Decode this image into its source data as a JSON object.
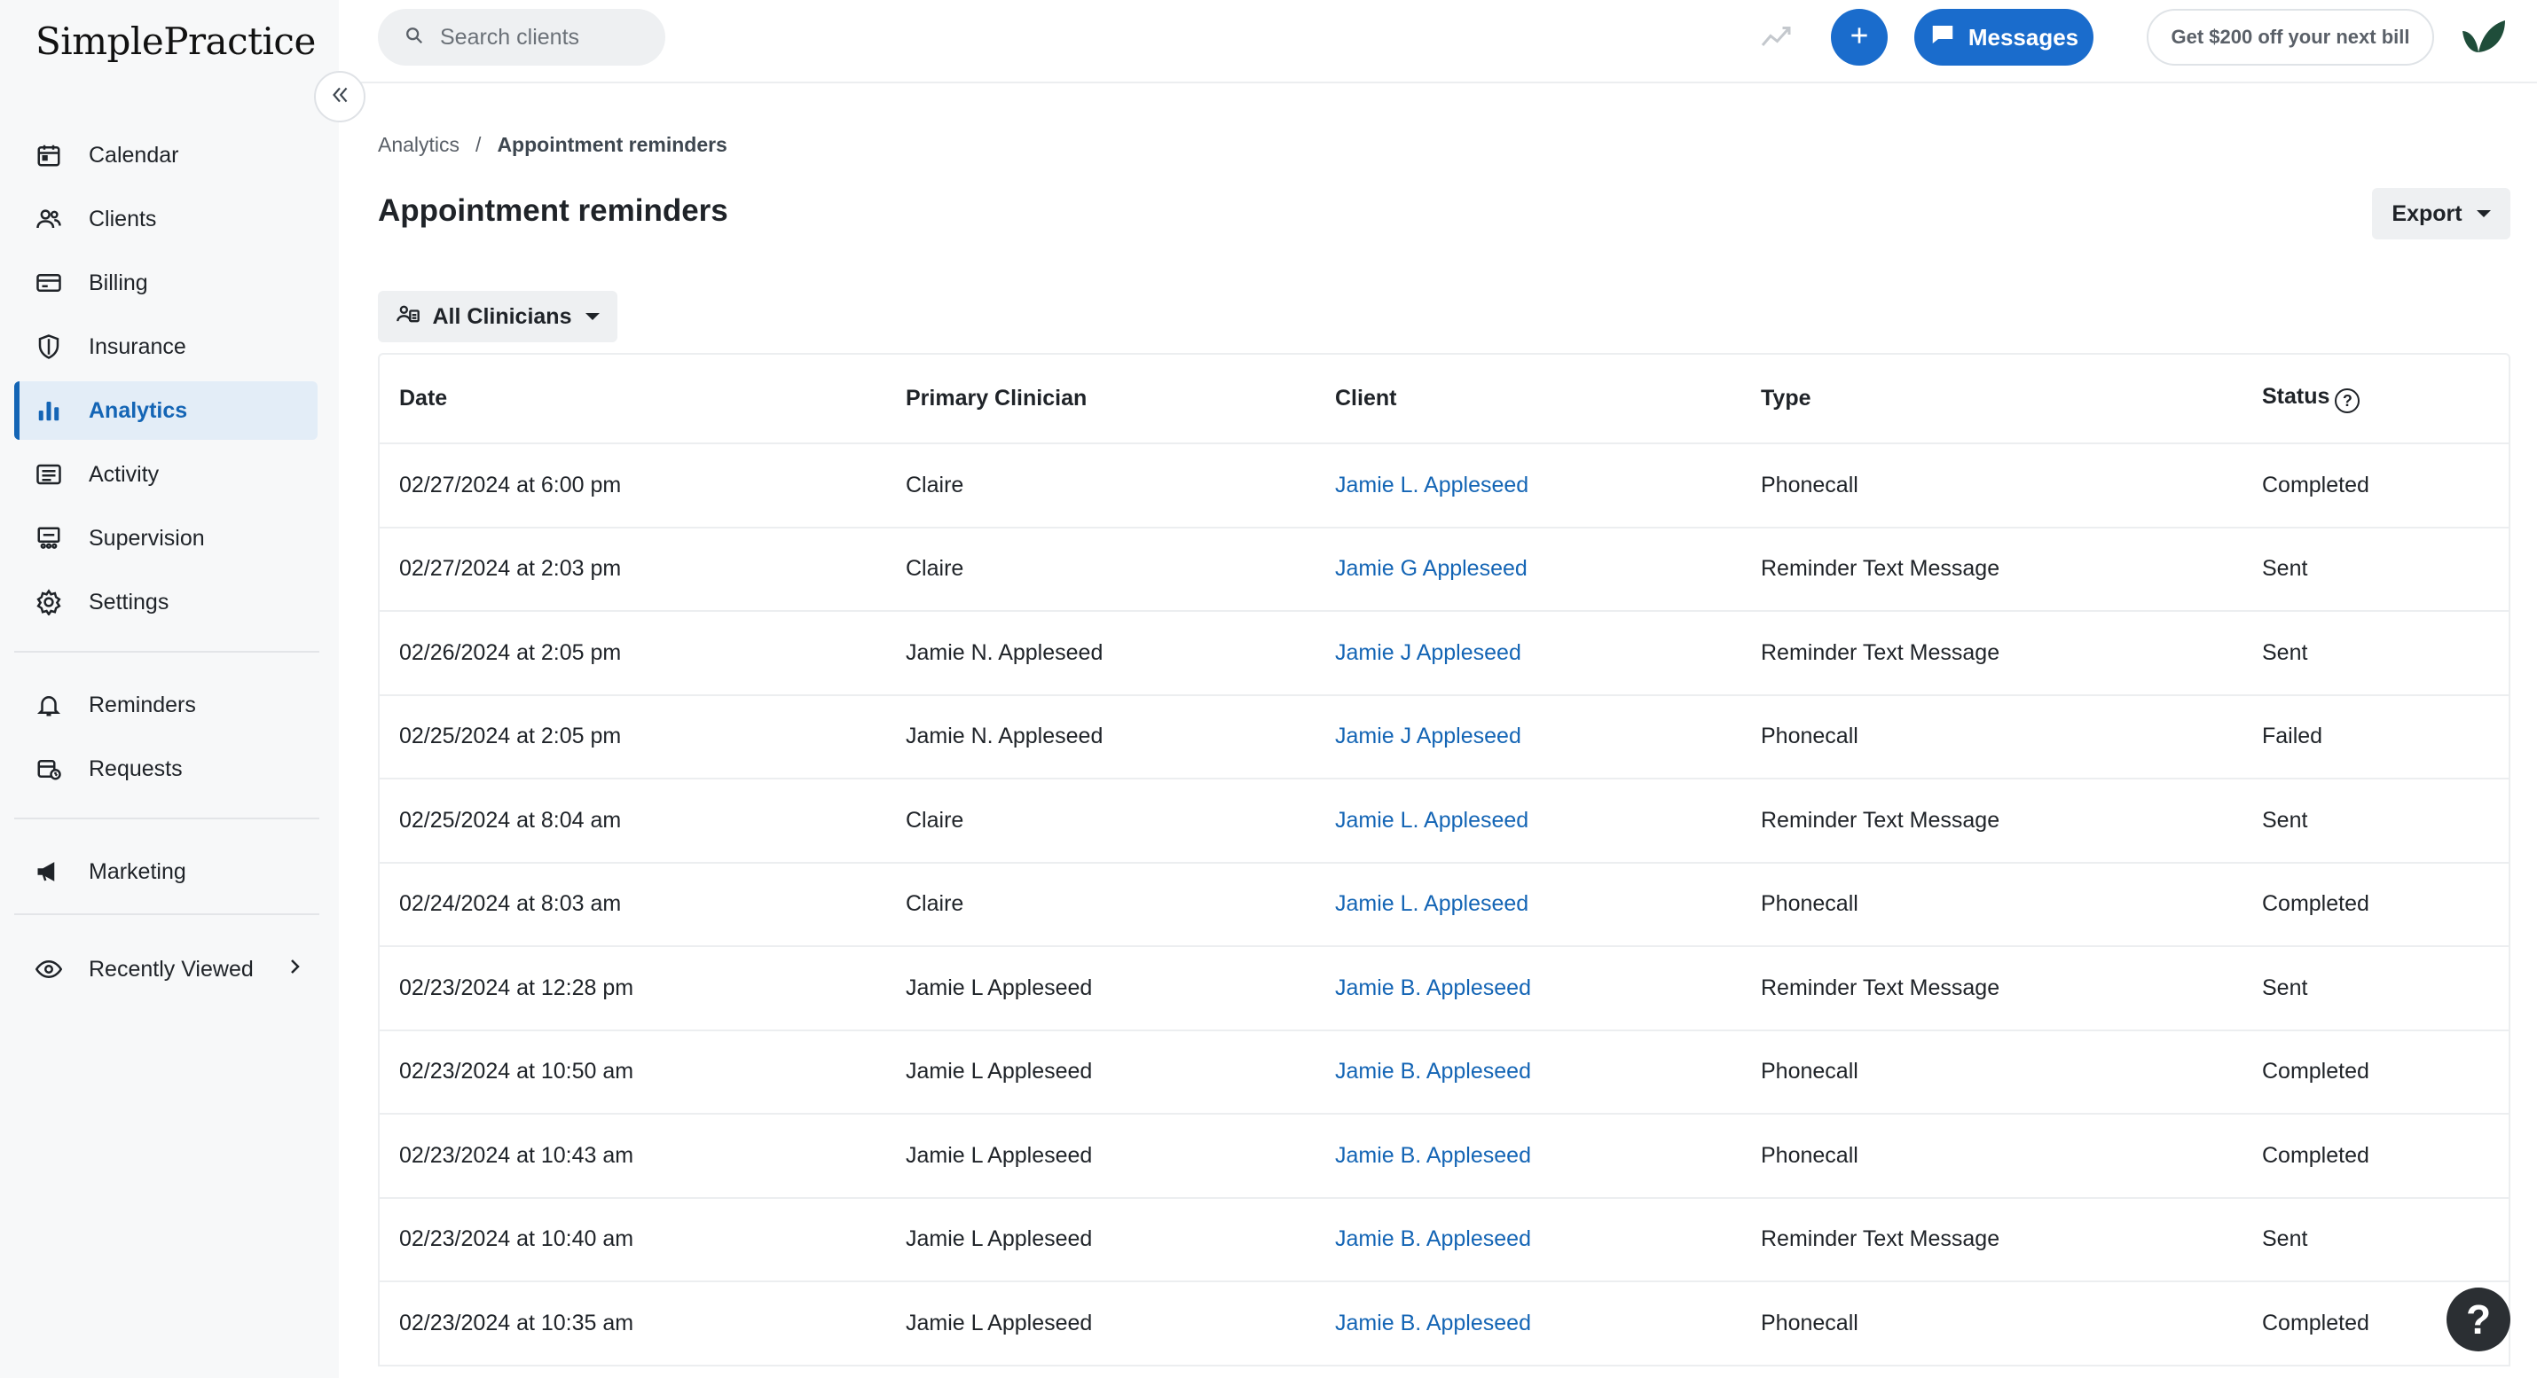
{
  "brand": {
    "logo_text": "SimplePractice"
  },
  "sidebar": {
    "items": [
      {
        "label": "Calendar",
        "icon": "calendar-icon"
      },
      {
        "label": "Clients",
        "icon": "clients-icon"
      },
      {
        "label": "Billing",
        "icon": "billing-card-icon"
      },
      {
        "label": "Insurance",
        "icon": "shield-icon"
      },
      {
        "label": "Analytics",
        "icon": "bar-chart-icon",
        "active": true
      },
      {
        "label": "Activity",
        "icon": "activity-list-icon"
      },
      {
        "label": "Supervision",
        "icon": "supervision-icon"
      },
      {
        "label": "Settings",
        "icon": "gear-icon"
      }
    ],
    "secondary": [
      {
        "label": "Reminders",
        "icon": "bell-icon"
      },
      {
        "label": "Requests",
        "icon": "calendar-request-icon"
      }
    ],
    "marketing": {
      "label": "Marketing",
      "icon": "megaphone-icon"
    },
    "recently_viewed": {
      "label": "Recently Viewed",
      "icon": "eye-icon"
    }
  },
  "topbar": {
    "search_placeholder": "Search clients",
    "messages_label": "Messages",
    "promo_label": "Get $200 off your next bill"
  },
  "breadcrumb": {
    "parent": "Analytics",
    "separator": "/",
    "current": "Appointment reminders"
  },
  "page": {
    "title": "Appointment reminders",
    "export_label": "Export",
    "filter_label": "All Clinicians"
  },
  "table": {
    "headers": [
      "Date",
      "Primary Clinician",
      "Client",
      "Type",
      "Status"
    ],
    "rows": [
      [
        "02/27/2024 at 6:00 pm",
        "Claire",
        "Jamie L. Appleseed",
        "Phonecall",
        "Completed"
      ],
      [
        "02/27/2024 at 2:03 pm",
        "Claire",
        "Jamie G Appleseed",
        "Reminder Text Message",
        "Sent"
      ],
      [
        "02/26/2024 at 2:05 pm",
        "Jamie N. Appleseed",
        "Jamie J Appleseed",
        "Reminder Text Message",
        "Sent"
      ],
      [
        "02/25/2024 at 2:05 pm",
        "Jamie N. Appleseed",
        "Jamie J Appleseed",
        "Phonecall",
        "Failed"
      ],
      [
        "02/25/2024 at 8:04 am",
        "Claire",
        "Jamie L. Appleseed",
        "Reminder Text Message",
        "Sent"
      ],
      [
        "02/24/2024 at 8:03 am",
        "Claire",
        "Jamie L. Appleseed",
        "Phonecall",
        "Completed"
      ],
      [
        "02/23/2024 at 12:28 pm",
        "Jamie L Appleseed",
        "Jamie B. Appleseed",
        "Reminder Text Message",
        "Sent"
      ],
      [
        "02/23/2024 at 10:50 am",
        "Jamie L Appleseed",
        "Jamie B. Appleseed",
        "Phonecall",
        "Completed"
      ],
      [
        "02/23/2024 at 10:43 am",
        "Jamie L Appleseed",
        "Jamie B. Appleseed",
        "Phonecall",
        "Completed"
      ],
      [
        "02/23/2024 at 10:40 am",
        "Jamie L Appleseed",
        "Jamie B. Appleseed",
        "Reminder Text Message",
        "Sent"
      ],
      [
        "02/23/2024 at 10:35 am",
        "Jamie L Appleseed",
        "Jamie B. Appleseed",
        "Phonecall",
        "Completed"
      ]
    ]
  },
  "help": {
    "label": "?"
  },
  "colors": {
    "accent": "#1a6ccc",
    "link": "#1465b5",
    "active_bg": "#e3edf7",
    "sidebar_bg": "#f7f8f9"
  }
}
